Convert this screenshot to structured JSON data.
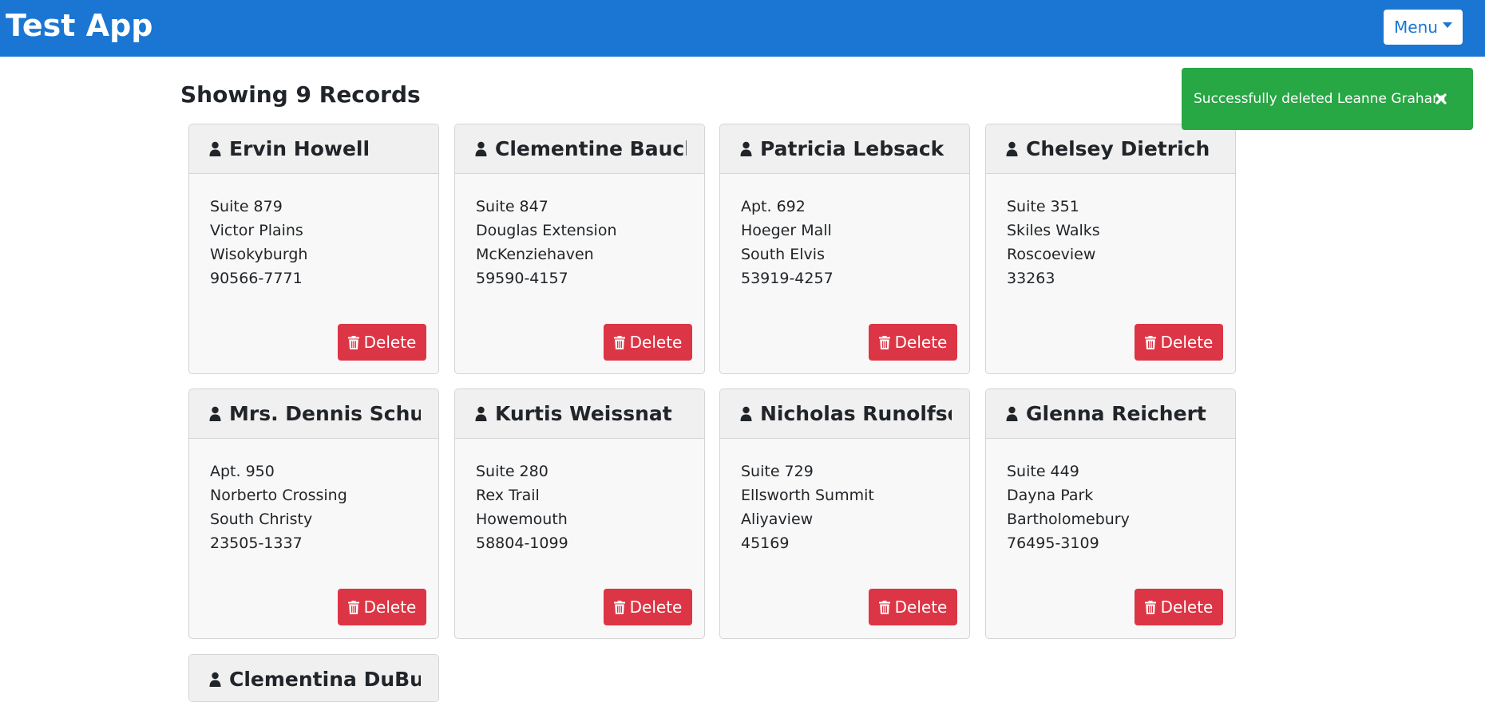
{
  "app": {
    "title": "Test App"
  },
  "menu": {
    "label": "Menu"
  },
  "heading": "Showing 9 Records",
  "toast": {
    "message": "Successfully deleted Leanne Graham",
    "color": "#28a745"
  },
  "colors": {
    "navbar": "#1a76d2",
    "delete": "#dc3545"
  },
  "delete_label": "Delete",
  "cards": [
    {
      "name": "Ervin Howell",
      "suite": "Suite 879",
      "street": "Victor Plains",
      "city": "Wisokyburgh",
      "zip": "90566-7771"
    },
    {
      "name": "Clementine Bauch",
      "suite": "Suite 847",
      "street": "Douglas Extension",
      "city": "McKenziehaven",
      "zip": "59590-4157"
    },
    {
      "name": "Patricia Lebsack",
      "suite": "Apt. 692",
      "street": "Hoeger Mall",
      "city": "South Elvis",
      "zip": "53919-4257"
    },
    {
      "name": "Chelsey Dietrich",
      "suite": "Suite 351",
      "street": "Skiles Walks",
      "city": "Roscoeview",
      "zip": "33263"
    },
    {
      "name": "Mrs. Dennis Schulist",
      "suite": "Apt. 950",
      "street": "Norberto Crossing",
      "city": "South Christy",
      "zip": "23505-1337"
    },
    {
      "name": "Kurtis Weissnat",
      "suite": "Suite 280",
      "street": "Rex Trail",
      "city": "Howemouth",
      "zip": "58804-1099"
    },
    {
      "name": "Nicholas Runolfsd...",
      "suite": "Suite 729",
      "street": "Ellsworth Summit",
      "city": "Aliyaview",
      "zip": "45169"
    },
    {
      "name": "Glenna Reichert",
      "suite": "Suite 449",
      "street": "Dayna Park",
      "city": "Bartholomebury",
      "zip": "76495-3109"
    },
    {
      "name": "Clementina DuBuq...",
      "suite": "",
      "street": "",
      "city": "",
      "zip": ""
    }
  ]
}
